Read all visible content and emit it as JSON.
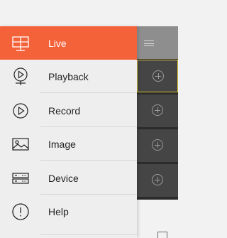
{
  "drawer": {
    "active_color": "#f4623a",
    "items": [
      {
        "label": "Live",
        "icon": "live-monitor-icon",
        "active": true
      },
      {
        "label": "Playback",
        "icon": "playback-icon",
        "active": false
      },
      {
        "label": "Record",
        "icon": "record-icon",
        "active": false
      },
      {
        "label": "Image",
        "icon": "image-icon",
        "active": false
      },
      {
        "label": "Device",
        "icon": "device-icon",
        "active": false
      },
      {
        "label": "Help",
        "icon": "help-icon",
        "active": false
      }
    ]
  },
  "background": {
    "header_icon": "menu-icon",
    "channel_cells": [
      {
        "icon": "add-channel-icon",
        "selected": true
      },
      {
        "icon": "add-channel-icon",
        "selected": false
      },
      {
        "icon": "add-channel-icon",
        "selected": false
      },
      {
        "icon": "add-channel-icon",
        "selected": false
      }
    ]
  }
}
